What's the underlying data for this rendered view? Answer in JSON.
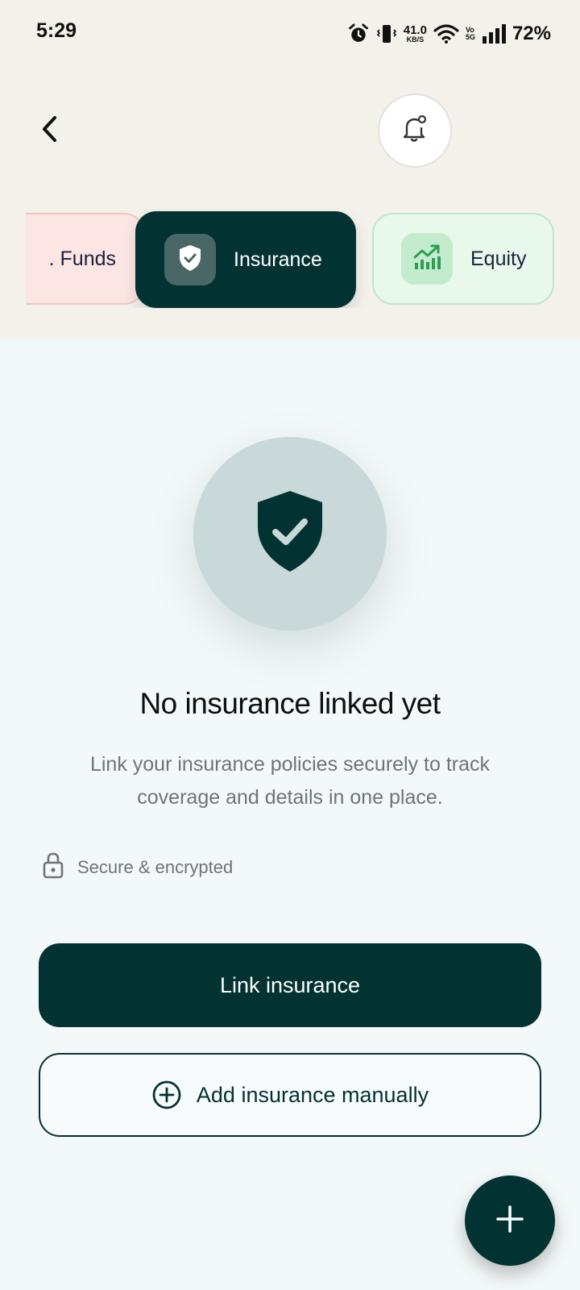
{
  "status_bar": {
    "time": "5:29",
    "net_speed_value": "41.0",
    "net_speed_unit": "KB/S",
    "volte_top": "Vo",
    "volte_bottom": "5G",
    "battery": "72%"
  },
  "tabs": [
    {
      "label": ". Funds",
      "selected": false
    },
    {
      "label": "Insurance",
      "selected": true
    },
    {
      "label": "Equity",
      "selected": false
    }
  ],
  "empty_state": {
    "title": "No insurance linked yet",
    "description": "Link your insurance policies securely to track coverage and details in one place.",
    "secure_note": "Secure & encrypted"
  },
  "actions": {
    "primary_label": "Link insurance",
    "secondary_label": "Add insurance manually"
  },
  "colors": {
    "primary": "#033233",
    "funds_bg": "#fbe6e3",
    "equity_bg": "#e8f9ec",
    "equity_icon": "#2e9e55"
  },
  "icons": {
    "back": "chevron-left-icon",
    "bell": "bell-icon",
    "insurance": "shield-check-icon",
    "equity": "chart-up-icon",
    "secure": "lock-icon",
    "add": "plus-circle-icon",
    "fab": "plus-icon"
  }
}
